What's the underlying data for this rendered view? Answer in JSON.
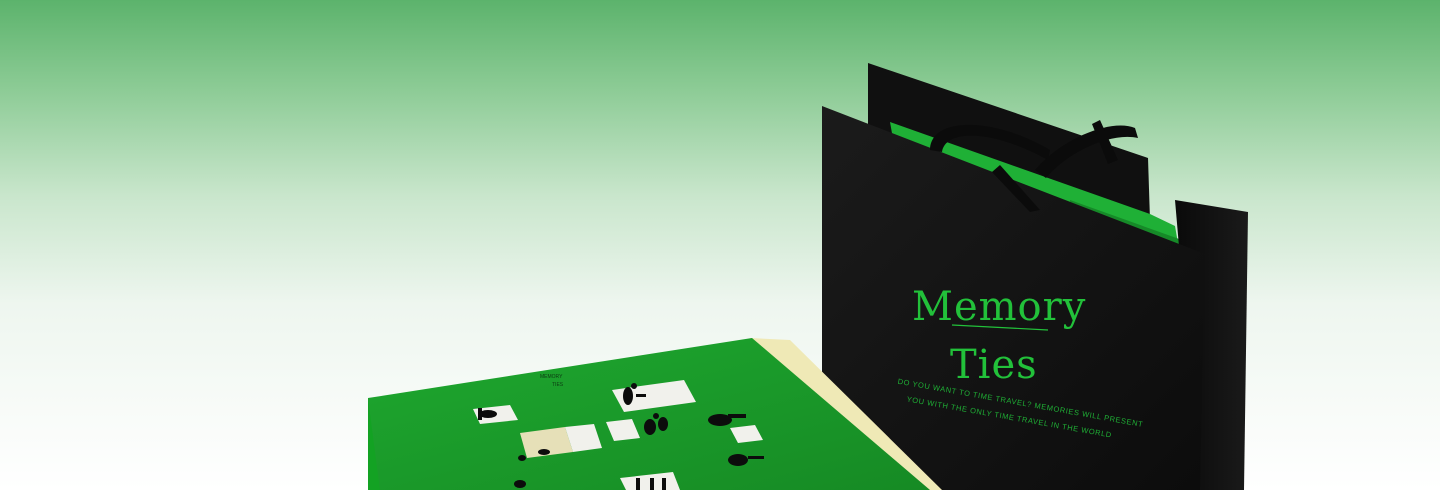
{
  "product": {
    "brand_line1": "Memory",
    "brand_line2": "Ties",
    "tagline_line1": "DO YOU WANT TO TIME TRAVEL? MEMORIES WILL PRESENT",
    "tagline_line2": "YOU WITH THE ONLY TIME TRAVEL IN THE WORLD",
    "box_mini_line1": "MEMORY",
    "box_mini_line2": "TIES"
  },
  "colors": {
    "accent_green": "#22c13a",
    "bag_black": "#141414",
    "box_green": "#1c9b2a",
    "box_edge_cream": "#efe9b6"
  }
}
